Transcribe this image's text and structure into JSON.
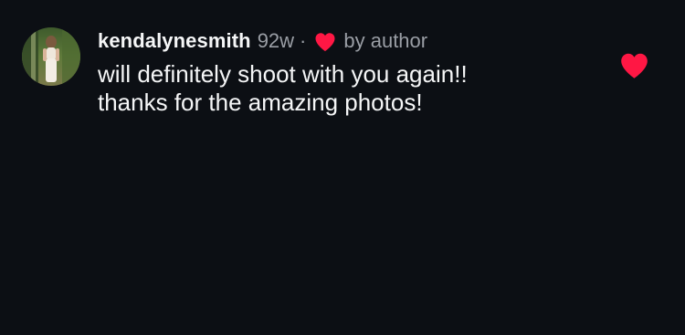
{
  "comment": {
    "username": "kendalynesmith",
    "time": "92w",
    "separator": "·",
    "author_label": "by author",
    "lines": [
      "will definitely shoot with you again!!",
      "thanks for the amazing photos!"
    ],
    "liked": true,
    "liked_by_author": true
  },
  "icons": {
    "author_heart": "heart-icon",
    "like_button": "heart-icon"
  },
  "colors": {
    "background": "#0c0f14",
    "primary_text": "#f5f6f7",
    "secondary_text": "#9a9ea5",
    "heart_red": "#ff1744"
  }
}
